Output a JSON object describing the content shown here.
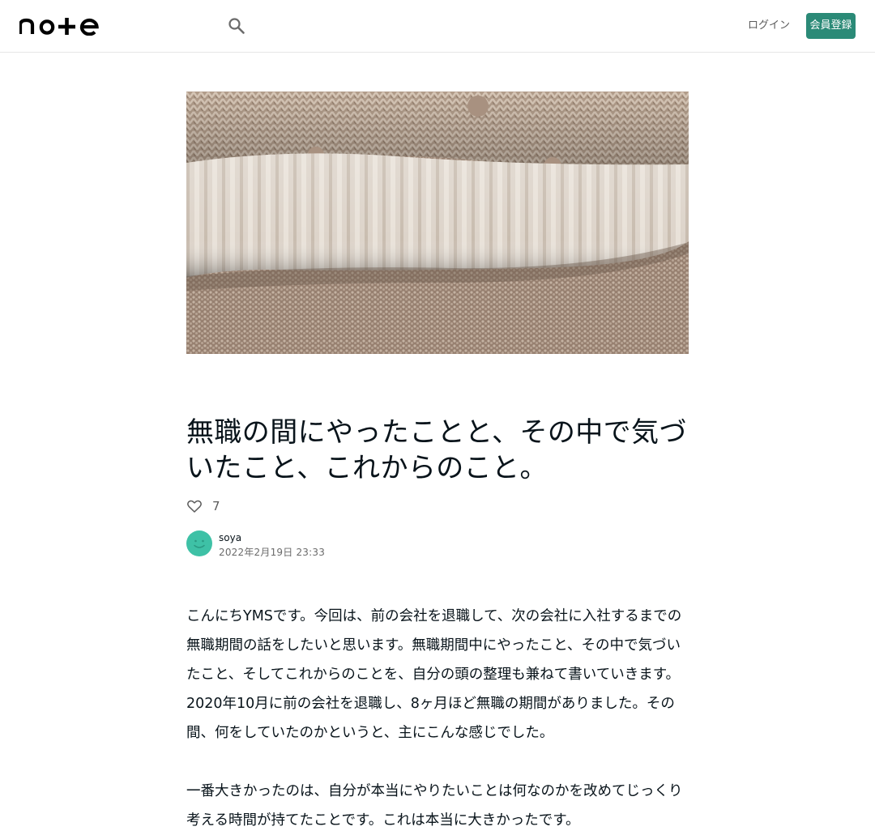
{
  "header": {
    "logo_text": "note",
    "search_icon": "search-icon",
    "login_label": "ログイン",
    "signup_label": "会員登録",
    "brand_color": "#2b8a77"
  },
  "article": {
    "hero_image": "stacked-knit-sweaters-photo",
    "title": "無職の間にやったことと、その中で気づいたこと、これからのこと。",
    "likes": "7",
    "author": {
      "name": "soya",
      "date": "2022年2月19日 23:33",
      "avatar_color": "#3ec1a6"
    },
    "paragraphs": [
      "こんにちYMSです。今回は、前の会社を退職して、次の会社に入社するまでの無職期間の話をしたいと思います。無職期間中にやったこと、その中で気づいたこと、そしてこれからのことを、自分の頭の整理も兼ねて書いていきます。",
      "2020年10月に前の会社を退職し、8ヶ月ほど無職の期間がありました。その間、何をしていたのかというと、主にこんな感じでした。",
      "一番大きかったのは、自分が本当にやりたいことは何なのかを改めてじっくり考える時間が持てたことです。これは本当に大きかったです。"
    ]
  }
}
